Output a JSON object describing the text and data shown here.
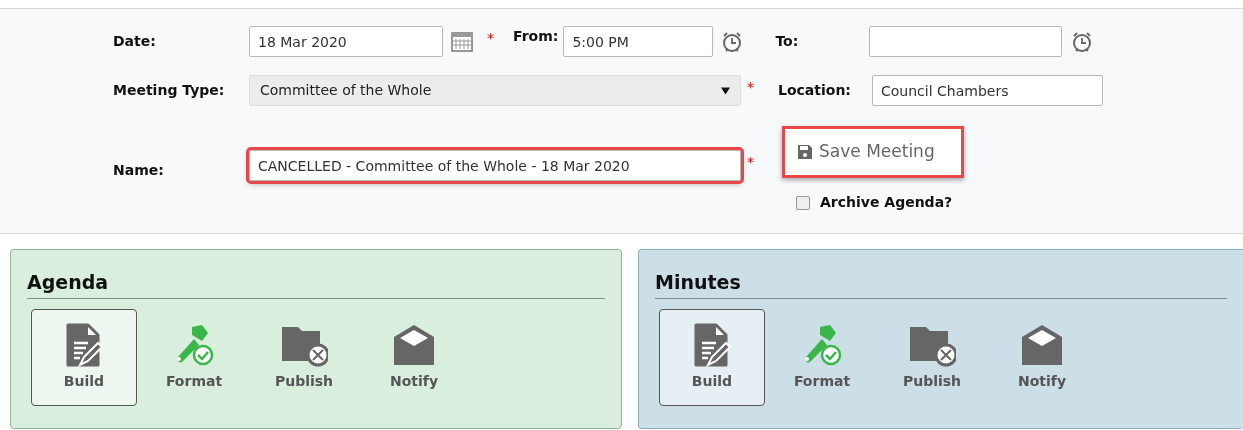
{
  "form": {
    "date": {
      "label": "Date:",
      "value": "18 Mar 2020",
      "required_mark": "*"
    },
    "from": {
      "label": "From:",
      "value": "5:00 PM"
    },
    "to": {
      "label": "To:"
    },
    "meeting_type": {
      "label": "Meeting Type:",
      "value": "Committee of the Whole",
      "required_mark": "*"
    },
    "location": {
      "label": "Location:",
      "value": "Council Chambers"
    },
    "name": {
      "label": "Name:",
      "value": "CANCELLED - Committee of the Whole - 18 Mar 2020",
      "required_mark": "*",
      "highlighted": true
    },
    "save_button": {
      "label": "Save Meeting",
      "highlighted": true
    },
    "archive_agenda": {
      "label": "Archive Agenda?",
      "checked": false
    }
  },
  "panels": [
    {
      "title": "Agenda",
      "kind": "agenda",
      "actions": [
        {
          "label": "Build",
          "kind": "build",
          "selected": true
        },
        {
          "label": "Format",
          "kind": "format",
          "selected": false
        },
        {
          "label": "Publish",
          "kind": "publish",
          "selected": false
        },
        {
          "label": "Notify",
          "kind": "notify",
          "selected": false
        }
      ]
    },
    {
      "title": "Minutes",
      "kind": "minutes",
      "actions": [
        {
          "label": "Build",
          "kind": "build",
          "selected": true
        },
        {
          "label": "Format",
          "kind": "format",
          "selected": false
        },
        {
          "label": "Publish",
          "kind": "publish",
          "selected": false
        },
        {
          "label": "Notify",
          "kind": "notify",
          "selected": false
        }
      ]
    }
  ]
}
